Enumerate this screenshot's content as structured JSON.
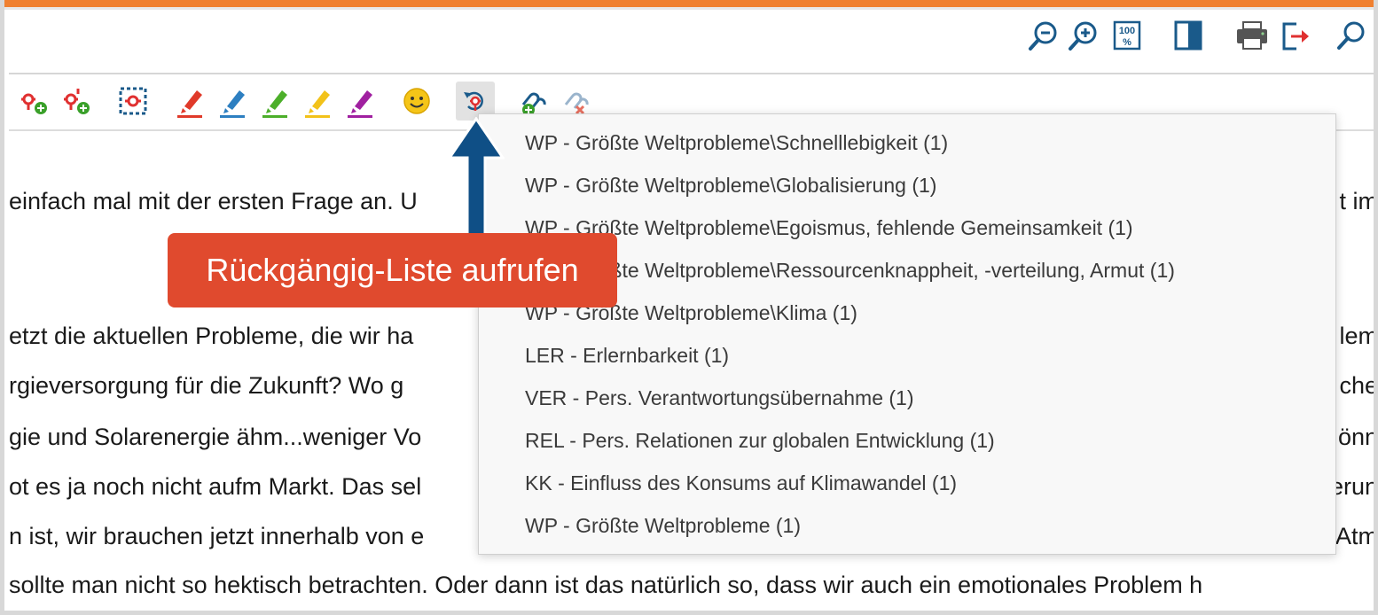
{
  "colors": {
    "accent_orange": "#f08030",
    "icon_blue": "#1a5a8a",
    "code_red": "#e03030",
    "callout_bg": "#e04a2e",
    "arrow_blue": "#0f4f86"
  },
  "top_toolbar": {
    "buttons": [
      {
        "name": "zoom-out-icon"
      },
      {
        "name": "zoom-in-icon"
      },
      {
        "name": "zoom-100-icon",
        "label": "100"
      },
      {
        "name": "panel-toggle-icon"
      },
      {
        "name": "print-icon"
      },
      {
        "name": "export-icon"
      },
      {
        "name": "search-icon"
      }
    ]
  },
  "coding_toolbar": {
    "buttons": [
      {
        "name": "code-add-icon"
      },
      {
        "name": "code-add-multi-icon"
      },
      {
        "name": "code-select-icon"
      },
      {
        "name": "highlighter-red-icon",
        "color": "#e03a2a"
      },
      {
        "name": "highlighter-blue-icon",
        "color": "#2d7fc1"
      },
      {
        "name": "highlighter-green-icon",
        "color": "#4caf2a"
      },
      {
        "name": "highlighter-yellow-icon",
        "color": "#f2c21a"
      },
      {
        "name": "highlighter-purple-icon",
        "color": "#a020a0"
      },
      {
        "name": "emoticon-icon"
      },
      {
        "name": "undo-list-icon"
      },
      {
        "name": "link-add-icon"
      },
      {
        "name": "link-remove-icon"
      }
    ]
  },
  "document": {
    "lines": [
      {
        "left": "einfach mal mit der ersten Frage an. U",
        "right": "t im"
      },
      {
        "left": "etzt die aktuellen Probleme, die wir ha",
        "right": "lem"
      },
      {
        "left": "rgieversorgung für die Zukunft? Wo g",
        "right": "che"
      },
      {
        "left": "gie und Solarenergie ähm...weniger Vo",
        "right": "önn"
      },
      {
        "left": "ot es ja noch nicht aufm Markt. Das sel",
        "right": "erun"
      },
      {
        "left": "n ist, wir brauchen jetzt innerhalb von e",
        "right": "Atm"
      },
      {
        "left": "sollte man nicht so hektisch betrachten. Oder dann ist das natürlich so, dass wir auch ein emotionales Problem h",
        "right": ""
      }
    ]
  },
  "undo_list": {
    "items": [
      "WP - Größte Weltprobleme\\Schnelllebigkeit (1)",
      "WP - Größte Weltprobleme\\Globalisierung (1)",
      "WP - Größte Weltprobleme\\Egoismus, fehlende Gemeinsamkeit (1)",
      "WP - Größte Weltprobleme\\Ressourcenknappheit, -verteilung, Armut (1)",
      "WP - Größte Weltprobleme\\Klima (1)",
      "LER - Erlernbarkeit (1)",
      "VER - Pers. Verantwortungsübernahme (1)",
      "REL - Pers. Relationen zur globalen Entwicklung (1)",
      "KK - Einfluss des Konsums auf Klimawandel (1)",
      "WP - Größte Weltprobleme (1)"
    ]
  },
  "callout": {
    "text": "Rückgängig-Liste aufrufen"
  }
}
